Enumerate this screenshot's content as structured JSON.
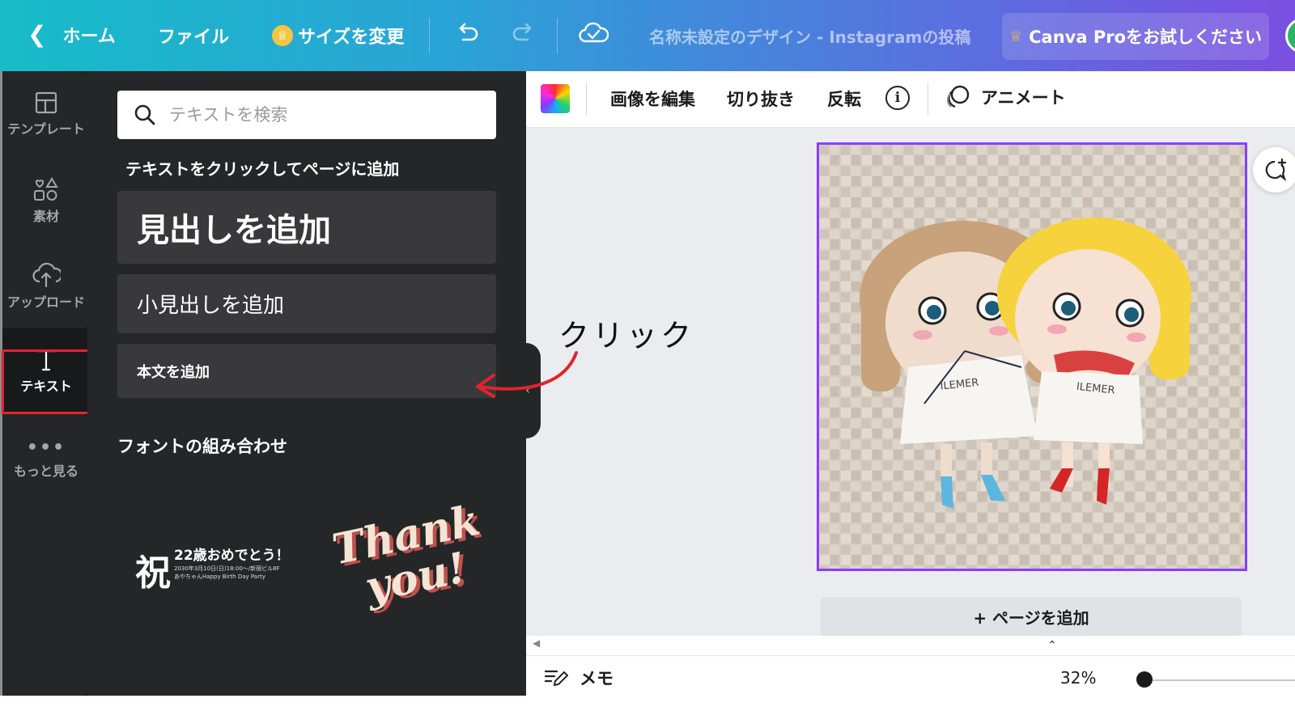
{
  "topbar": {
    "home_label": "ホーム",
    "file_label": "ファイル",
    "resize_label": "サイズを変更",
    "design_title": "名称未設定のデザイン - Instagramの投稿",
    "pro_label": "Canva Proをお試しください",
    "icons": {
      "back": "chevron-left-icon",
      "crown": "crown-icon",
      "undo": "undo-icon",
      "redo": "redo-icon",
      "saved": "cloud-check-icon"
    }
  },
  "rail": {
    "items": [
      {
        "label": "テンプレート",
        "icon": "template-icon"
      },
      {
        "label": "素材",
        "icon": "elements-icon"
      },
      {
        "label": "アップロード",
        "icon": "upload-icon"
      },
      {
        "label": "テキスト",
        "icon": "text-icon",
        "active": true
      },
      {
        "label": "もっと見る",
        "icon": "more-icon"
      }
    ]
  },
  "panel": {
    "search_placeholder": "テキストを検索",
    "hint": "テキストをクリックしてページに追加",
    "heading_label": "見出しを追加",
    "subheading_label": "小見出しを追加",
    "body_label": "本文を追加",
    "font_combos_title": "フォントの組み合わせ",
    "combo1": {
      "kanji": "祝",
      "line1": "22歳おめでとう！",
      "line2": "2030年3月10日(日)18:00〜/新宿ビル8F",
      "line3": "あやちゃんHappy Birth Day Party"
    },
    "combo2": {
      "line1": "Thank",
      "line2": "you!"
    }
  },
  "toolbar": {
    "edit_image": "画像を編集",
    "crop": "切り抜き",
    "flip": "反転",
    "info": "i",
    "animate": "アニメート"
  },
  "canvas": {
    "add_page": "+ ページを追加",
    "doll_shirt_left": "ILEMER",
    "doll_shirt_right": "ILEMER"
  },
  "annotation": {
    "label": "クリック",
    "color": "#e0242b"
  },
  "bottombar": {
    "memo_label": "メモ",
    "zoom": "32%"
  },
  "colors": {
    "selection": "#8b3dff",
    "panel_bg": "#252627",
    "highlight": "#e0242b"
  }
}
